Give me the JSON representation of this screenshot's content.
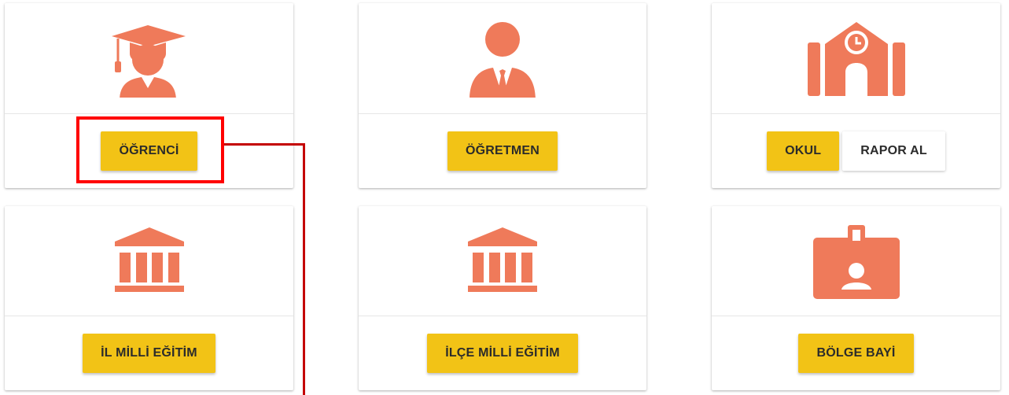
{
  "colors": {
    "accent_icon": "#ef7a5a",
    "button_yellow": "#f2c316",
    "highlight_red": "#ff0000"
  },
  "cards": [
    {
      "icon": "student-graduate-icon",
      "buttons": [
        "ÖĞRENCİ"
      ]
    },
    {
      "icon": "teacher-icon",
      "buttons": [
        "ÖĞRETMEN"
      ]
    },
    {
      "icon": "school-building-icon",
      "buttons": [
        "OKUL",
        "RAPOR AL"
      ]
    },
    {
      "icon": "institution-building-icon",
      "buttons": [
        "İL MİLLİ EĞİTİM"
      ]
    },
    {
      "icon": "institution-building-icon",
      "buttons": [
        "İLÇE MİLLİ EĞİTİM"
      ]
    },
    {
      "icon": "id-badge-icon",
      "buttons": [
        "BÖLGE BAYİ"
      ]
    }
  ]
}
